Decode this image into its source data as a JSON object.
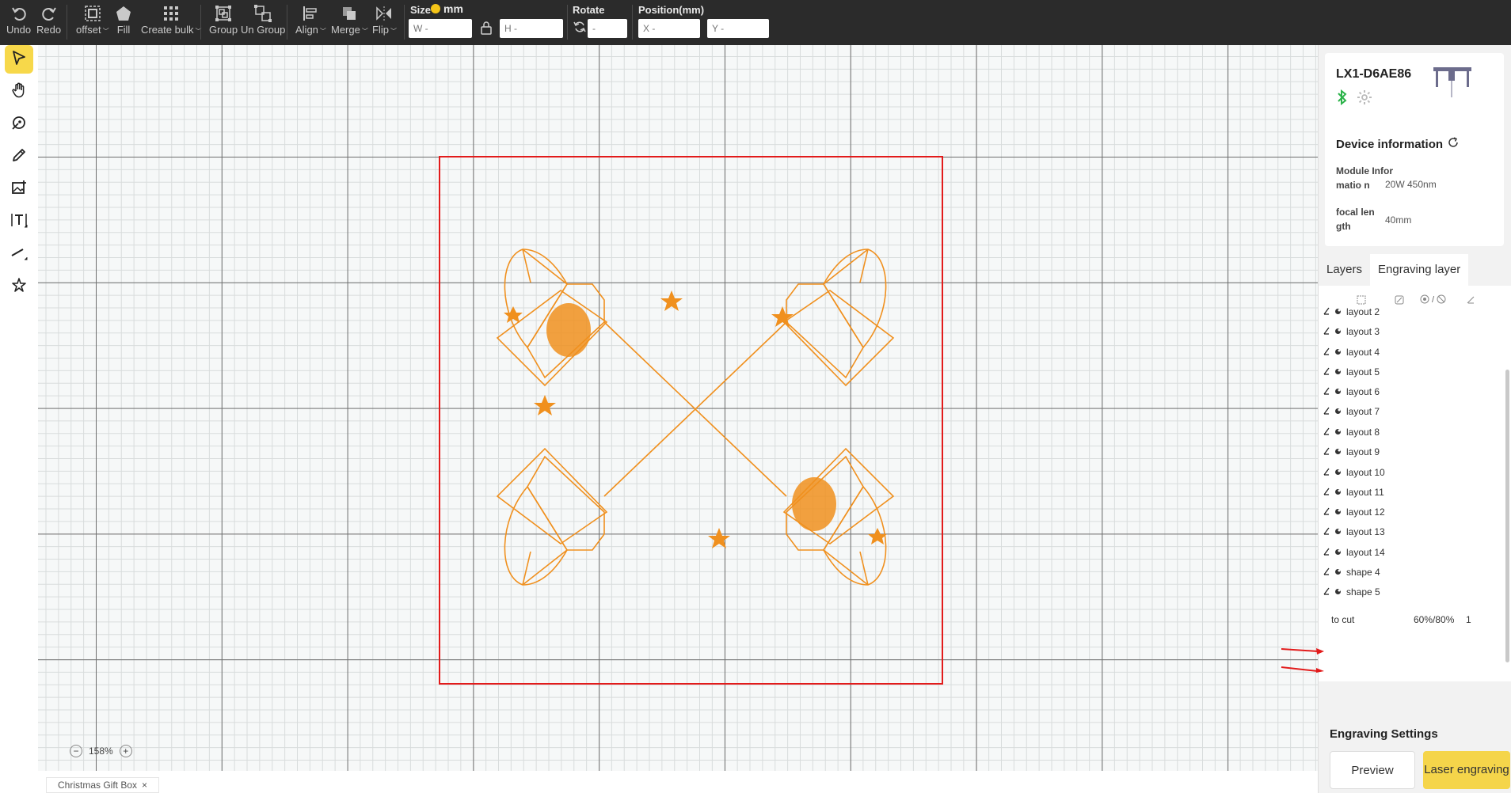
{
  "toolbar": {
    "undo": "Undo",
    "redo": "Redo",
    "offset": "offset",
    "fill": "Fill",
    "create_bulk": "Create bulk",
    "group": "Group",
    "ungroup": "Un Group",
    "align": "Align",
    "merge": "Merge",
    "flip": "Flip",
    "size_label": "Size",
    "size_unit": "mm",
    "w_placeholder": "W -",
    "h_placeholder": "H -",
    "rotate_label": "Rotate",
    "rotate_placeholder": "-",
    "position_label": "Position(mm)",
    "x_placeholder": "X -",
    "y_placeholder": "Y -"
  },
  "left_tools": [
    "select-tool",
    "hand-tool",
    "pen-tool",
    "pencil-tool",
    "image-tool",
    "text-tool",
    "line-tool",
    "shape-tool"
  ],
  "canvas": {
    "zoom_minus": "−",
    "zoom_level": "158%",
    "zoom_plus": "+",
    "design_color": "#f0901e",
    "workarea_color": "#e21b1b"
  },
  "file_tab": {
    "name": "Christmas Gift Box",
    "close": "×"
  },
  "device": {
    "name": "LX1-D6AE86",
    "info_title": "Device information",
    "module_label": "Module Informatio n",
    "module_value": "20W 450nm",
    "focal_label": "focal length",
    "focal_value": "40mm"
  },
  "tabs": {
    "layers": "Layers",
    "engraving_layer": "Engraving layer"
  },
  "layer_header": {
    "divider": "/"
  },
  "layers": [
    {
      "name": "layout 2"
    },
    {
      "name": "layout 3"
    },
    {
      "name": "layout 4"
    },
    {
      "name": "layout 5"
    },
    {
      "name": "layout 6"
    },
    {
      "name": "layout 7"
    },
    {
      "name": "layout 8"
    },
    {
      "name": "layout 9"
    },
    {
      "name": "layout 10"
    },
    {
      "name": "layout 11"
    },
    {
      "name": "layout 12"
    },
    {
      "name": "layout 13"
    },
    {
      "name": "layout 14"
    },
    {
      "name": "shape 4"
    },
    {
      "name": "shape 5"
    }
  ],
  "to_cut": {
    "label": "to cut",
    "value": "60%/80%",
    "count": "1"
  },
  "engraving": {
    "title": "Engraving Settings",
    "preview": "Preview",
    "laser": "Laser engraving"
  }
}
